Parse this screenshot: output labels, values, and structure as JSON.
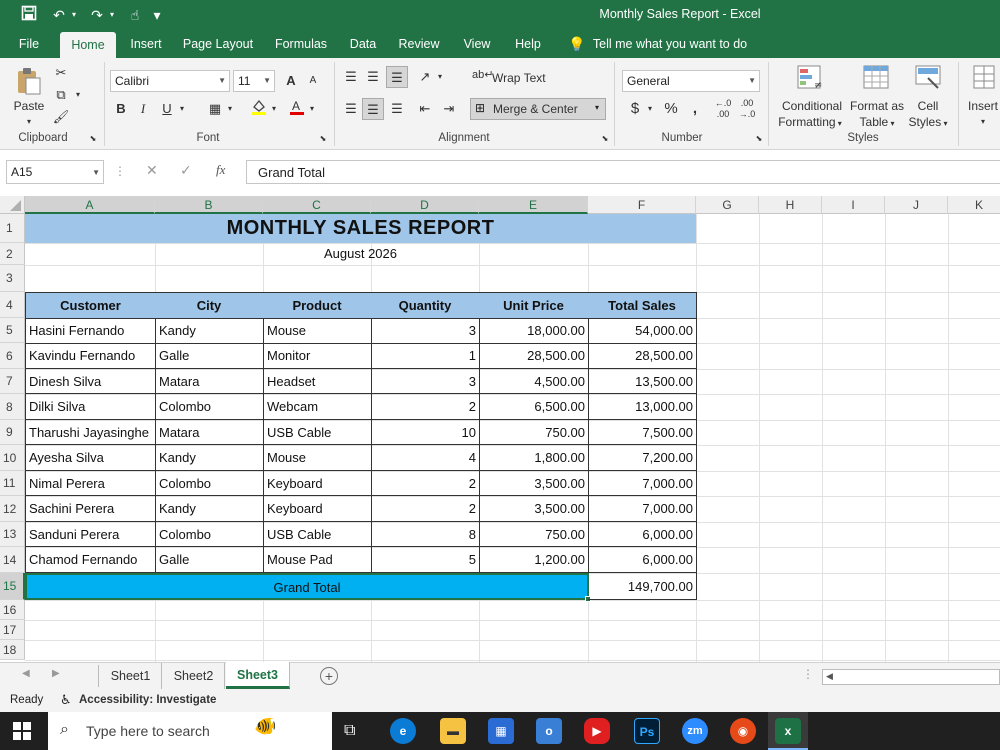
{
  "window": {
    "title": "Monthly Sales Report  -  Excel"
  },
  "quick_access": {
    "save_icon": "save-icon",
    "undo_icon": "undo-icon",
    "redo_icon": "redo-icon",
    "touch_icon": "touch-mode-icon",
    "customize": "▾"
  },
  "menu": {
    "file": "File",
    "home": "Home",
    "insert": "Insert",
    "page_layout": "Page Layout",
    "formulas": "Formulas",
    "data": "Data",
    "review": "Review",
    "view": "View",
    "help": "Help",
    "tell_me": "Tell me what you want to do"
  },
  "ribbon": {
    "clipboard": {
      "label": "Clipboard",
      "paste": "Paste"
    },
    "font": {
      "label": "Font",
      "name": "Calibri",
      "size": "11",
      "grow": "A",
      "shrink": "A",
      "bold": "B",
      "italic": "I",
      "underline": "U"
    },
    "alignment": {
      "label": "Alignment",
      "wrap_text": "Wrap Text",
      "merge_center": "Merge & Center"
    },
    "number": {
      "label": "Number",
      "format": "General",
      "currency": "$",
      "percent": "%",
      "comma": ","
    },
    "styles": {
      "label": "Styles",
      "conditional_1": "Conditional",
      "conditional_2": "Formatting",
      "format_table_1": "Format as",
      "format_table_2": "Table",
      "cell_styles_1": "Cell",
      "cell_styles_2": "Styles"
    },
    "cells": {
      "insert": "Insert"
    }
  },
  "formula_bar": {
    "name_box": "A15",
    "content": "Grand Total",
    "fx": "fx"
  },
  "columns": [
    "A",
    "B",
    "C",
    "D",
    "E",
    "F",
    "G",
    "H",
    "I",
    "J",
    "K"
  ],
  "rows": [
    "1",
    "2",
    "3",
    "4",
    "5",
    "6",
    "7",
    "8",
    "9",
    "10",
    "11",
    "12",
    "13",
    "14",
    "15",
    "16",
    "17",
    "18"
  ],
  "sheet": {
    "title": "MONTHLY  SALES  REPORT",
    "subtitle": "August 2026",
    "headers": [
      "Customer",
      "City",
      "Product",
      "Quantity",
      "Unit Price",
      "Total Sales"
    ],
    "data": [
      [
        "Hasini Fernando",
        "Kandy",
        "Mouse",
        "3",
        "18,000.00",
        "54,000.00"
      ],
      [
        "Kavindu Fernando",
        "Galle",
        "Monitor",
        "1",
        "28,500.00",
        "28,500.00"
      ],
      [
        "Dinesh Silva",
        "Matara",
        "Headset",
        "3",
        "4,500.00",
        "13,500.00"
      ],
      [
        "Dilki Silva",
        "Colombo",
        "Webcam",
        "2",
        "6,500.00",
        "13,000.00"
      ],
      [
        "Tharushi Jayasinghe",
        "Matara",
        "USB Cable",
        "10",
        "750.00",
        "7,500.00"
      ],
      [
        "Ayesha Silva",
        "Kandy",
        "Mouse",
        "4",
        "1,800.00",
        "7,200.00"
      ],
      [
        "Nimal Perera",
        "Colombo",
        "Keyboard",
        "2",
        "3,500.00",
        "7,000.00"
      ],
      [
        "Sachini Perera",
        "Kandy",
        "Keyboard",
        "2",
        "3,500.00",
        "7,000.00"
      ],
      [
        "Sanduni Perera",
        "Colombo",
        "USB Cable",
        "8",
        "750.00",
        "6,000.00"
      ],
      [
        "Chamod Fernando",
        "Galle",
        "Mouse Pad",
        "5",
        "1,200.00",
        "6,000.00"
      ]
    ],
    "grand_total_label": "Grand Total",
    "grand_total_value": "149,700.00"
  },
  "sheet_tabs": [
    "Sheet1",
    "Sheet2",
    "Sheet3"
  ],
  "active_sheet": "Sheet3",
  "status": {
    "ready": "Ready",
    "accessibility": "Accessibility: Investigate"
  },
  "taskbar": {
    "search_placeholder": "Type here to search",
    "ps": "Ps",
    "zm": "zm"
  },
  "colors": {
    "excel_green": "#217346",
    "header_fill": "#9fc5e8",
    "total_fill": "#00b0f0",
    "taskbar": "#202020"
  }
}
